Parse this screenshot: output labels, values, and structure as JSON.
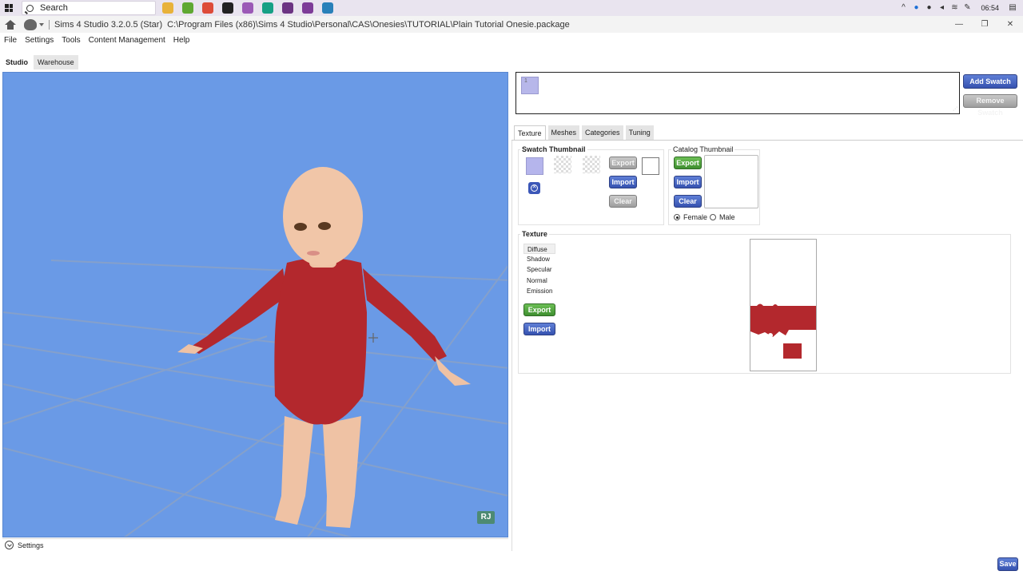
{
  "taskbar": {
    "search_placeholder": "Search",
    "clock": "06:54",
    "apps": [
      {
        "name": "file-manager-icon",
        "color": "#e8b23a"
      },
      {
        "name": "folder-icon",
        "color": "#5fa832"
      },
      {
        "name": "chrome-icon",
        "color": "#dd4b39"
      },
      {
        "name": "unity-icon",
        "color": "#222222"
      },
      {
        "name": "app-purple-icon",
        "color": "#9b59b6"
      },
      {
        "name": "app-green-icon",
        "color": "#16a085"
      },
      {
        "name": "app-violet-icon",
        "color": "#6c3483"
      },
      {
        "name": "app-magenta-icon",
        "color": "#7d3c98"
      },
      {
        "name": "app-blue-icon",
        "color": "#2980b9"
      }
    ]
  },
  "titlebar": {
    "app_name": "Sims 4 Studio 3.2.0.5 (Star)",
    "file_path": "C:\\Program Files (x86)\\Sims 4 Studio\\Personal\\CAS\\Onesies\\TUTORIAL\\Plain Tutorial Onesie.package"
  },
  "menu": [
    "File",
    "Settings",
    "Tools",
    "Content Management",
    "Help"
  ],
  "main_tabs": {
    "studio": "Studio",
    "warehouse": "Warehouse"
  },
  "viewport": {
    "badge": "RJ",
    "settings_label": "Settings",
    "colors": {
      "background": "#6a9ae6",
      "outfit": "#b3282d",
      "skin": "#f0c4a8"
    }
  },
  "swatch": {
    "chip_label": "1",
    "add_label": "Add Swatch",
    "remove_label": "Remove Swatch"
  },
  "subtabs": [
    "Texture",
    "Meshes",
    "Categories",
    "Tuning"
  ],
  "swatch_thumbnail": {
    "title": "Swatch Thumbnail",
    "export": "Export",
    "import": "Import",
    "clear": "Clear"
  },
  "catalog_thumbnail": {
    "title": "Catalog Thumbnail",
    "export": "Export",
    "import": "Import",
    "clear": "Clear",
    "female": "Female",
    "male": "Male"
  },
  "texture": {
    "title": "Texture",
    "items": [
      "Diffuse",
      "Shadow",
      "Specular",
      "Normal",
      "Emission"
    ],
    "selected": "Diffuse",
    "export": "Export",
    "import": "Import",
    "preview_color": "#b3282d"
  },
  "save_label": "Save"
}
